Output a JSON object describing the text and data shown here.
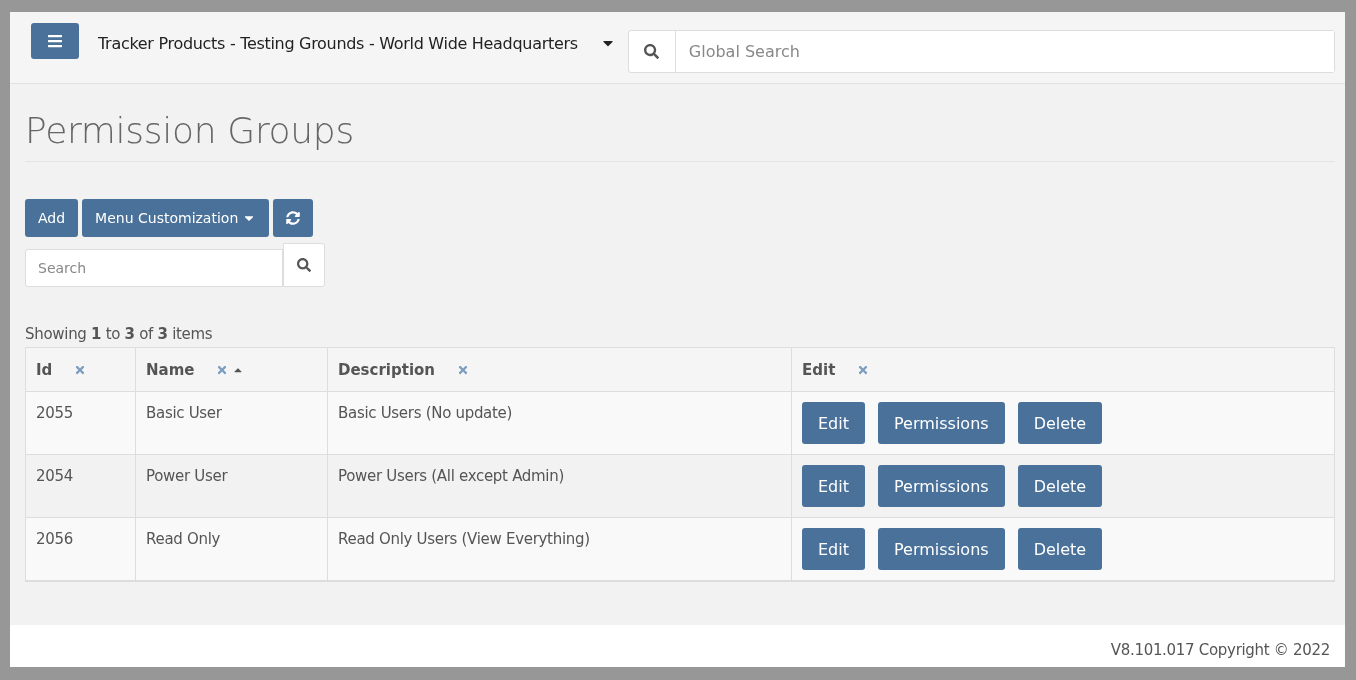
{
  "header": {
    "location": "Tracker Products - Testing Grounds - World Wide Headquarters",
    "search": {
      "placeholder": "Global Search"
    }
  },
  "page": {
    "title": "Permission Groups"
  },
  "toolbar": {
    "buttons": [
      {
        "label": "Add",
        "kind": "text"
      },
      {
        "label": "Menu Customization",
        "kind": "dropdown"
      },
      {
        "kind": "refresh"
      }
    ],
    "search": {
      "placeholder": "Search"
    }
  },
  "table": {
    "summary": "Showing **1** to **3** of **3** items",
    "columns": [
      {
        "label": "Id",
        "sorted": false
      },
      {
        "label": "Name",
        "sorted": true
      },
      {
        "label": "Description",
        "sorted": false
      },
      {
        "label": "Edit",
        "sorted": false
      }
    ],
    "rows": [
      {
        "id": "2055",
        "name": "Basic User",
        "description": "Basic Users (No update)",
        "actions": [
          "Edit",
          "Permissions",
          "Delete"
        ]
      },
      {
        "id": "2054",
        "name": "Power User",
        "description": "Power Users (All except Admin)",
        "actions": [
          "Edit",
          "Permissions",
          "Delete"
        ]
      },
      {
        "id": "2056",
        "name": "Read Only",
        "description": "Read Only Users (View Everything)",
        "actions": [
          "Edit",
          "Permissions",
          "Delete"
        ]
      }
    ]
  },
  "footer": {
    "text": "V8.101.017 Copyright © 2022"
  }
}
